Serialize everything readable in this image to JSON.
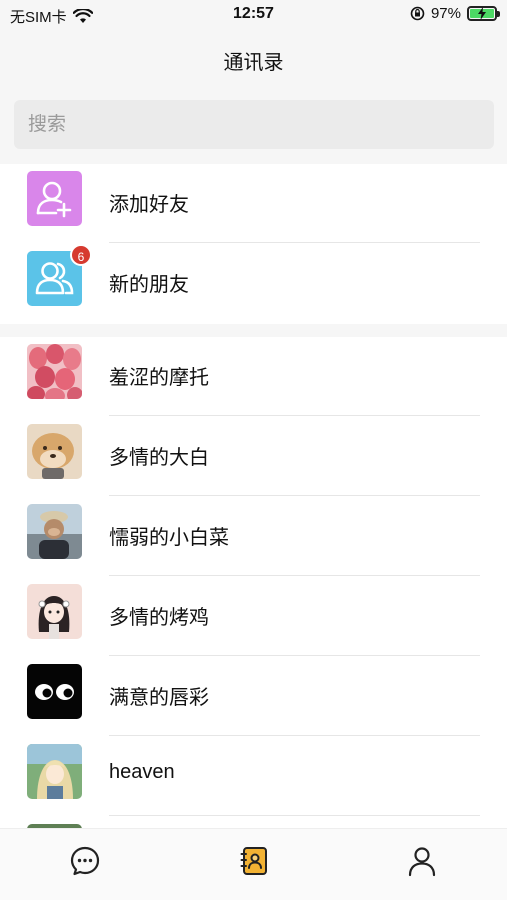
{
  "status_bar": {
    "carrier": "无SIM卡",
    "time": "12:57",
    "battery_percent": "97%"
  },
  "nav": {
    "title": "通讯录"
  },
  "search": {
    "placeholder": "搜索"
  },
  "system_items": [
    {
      "label": "添加好友",
      "icon": "add-friend-icon",
      "color": "#d986ea"
    },
    {
      "label": "新的朋友",
      "icon": "new-friends-icon",
      "color": "#5bc3e8",
      "badge": "6"
    }
  ],
  "contacts": [
    {
      "name": "羞涩的摩托",
      "avatar": "tulips-avatar"
    },
    {
      "name": "多情的大白",
      "avatar": "dog-avatar"
    },
    {
      "name": "懦弱的小白菜",
      "avatar": "monkey-avatar"
    },
    {
      "name": "多情的烤鸡",
      "avatar": "girl-avatar"
    },
    {
      "name": "满意的唇彩",
      "avatar": "eyes-avatar"
    },
    {
      "name": "heaven",
      "avatar": "anime-avatar"
    }
  ],
  "tabbar": {
    "tabs": [
      {
        "icon": "chat-icon"
      },
      {
        "icon": "contacts-icon",
        "active": true
      },
      {
        "icon": "profile-icon"
      }
    ]
  },
  "colors": {
    "badge": "#d63a2f",
    "accent": "#f2b233"
  }
}
